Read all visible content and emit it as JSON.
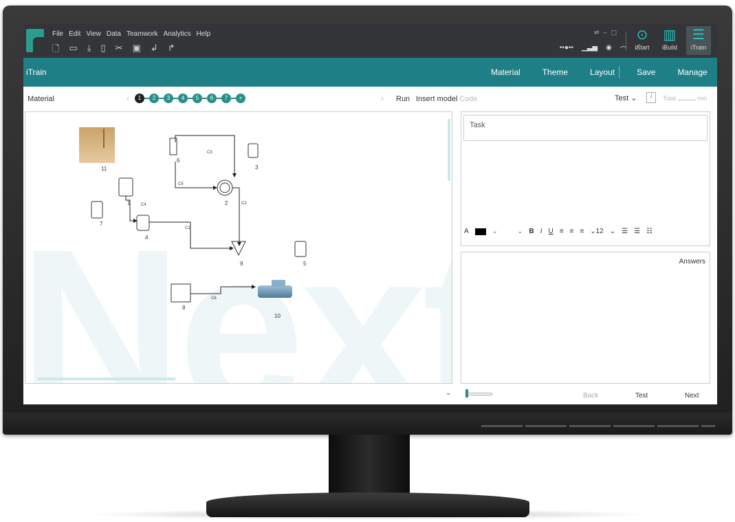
{
  "menu": [
    "File",
    "Edit",
    "View",
    "Data",
    "Teamwork",
    "Analytics",
    "Help"
  ],
  "toolbar_icons": [
    "new-file-icon",
    "open-folder-icon",
    "download-icon",
    "copy-icon",
    "cut-icon",
    "paste-icon",
    "undo-icon",
    "redo-icon"
  ],
  "apps": [
    {
      "label": "iStart",
      "icon": "⊙"
    },
    {
      "label": "iBuild",
      "icon": "▥"
    },
    {
      "label": "iTrain",
      "icon": "☰"
    }
  ],
  "nav": {
    "title": "iTrain",
    "items": [
      "Material",
      "Theme",
      "Layout",
      "Save",
      "Manage"
    ]
  },
  "sub": {
    "title": "Material",
    "steps": [
      "1",
      "2",
      "3",
      "4",
      "5",
      "6",
      "7",
      "+"
    ],
    "run": "Run",
    "insert_model": "Insert model",
    "code": "Code",
    "test": "Test",
    "total": "Total",
    "min": "min"
  },
  "diagram": {
    "nodes": [
      "11",
      "1",
      "2",
      "3",
      "4",
      "5",
      "6",
      "7",
      "8",
      "9",
      "10"
    ],
    "streams": [
      "C1",
      "C2",
      "C3",
      "C4",
      "C5",
      "C6"
    ]
  },
  "task": {
    "label": "Task",
    "font_letter": "A",
    "font_size": "12",
    "bold": "B",
    "italic": "I",
    "underline": "U"
  },
  "answers": {
    "label": "Answers"
  },
  "bottom": {
    "back": "Back",
    "test": "Test",
    "next": "Next"
  },
  "watermark": "Nexten",
  "colors": {
    "accent": "#1f7f86",
    "topbar": "#333538",
    "step": "#2a8f88"
  }
}
